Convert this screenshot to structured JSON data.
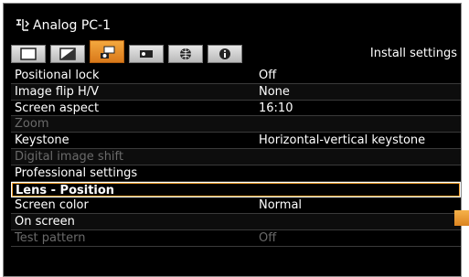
{
  "header": {
    "title": "Analog PC-1",
    "source_icon": "input-source-icon"
  },
  "tabs": [
    {
      "icon": "picture-adjust-icon"
    },
    {
      "icon": "image-adjust-icon"
    },
    {
      "icon": "install-settings-icon",
      "active": true
    },
    {
      "icon": "system-settings-icon"
    },
    {
      "icon": "network-settings-icon"
    },
    {
      "icon": "information-icon"
    }
  ],
  "section_label": "Install settings",
  "menu": {
    "items": [
      {
        "label": "Positional lock",
        "value": "Off",
        "enabled": true
      },
      {
        "label": "Image flip H/V",
        "value": "None",
        "enabled": true
      },
      {
        "label": "Screen aspect",
        "value": "16:10",
        "enabled": true
      },
      {
        "label": "Zoom",
        "value": "",
        "enabled": false
      },
      {
        "label": "Keystone",
        "value": "Horizontal-vertical keystone",
        "enabled": true
      },
      {
        "label": "Digital image shift",
        "value": "",
        "enabled": false
      },
      {
        "label": "Professional settings",
        "value": "",
        "enabled": true
      },
      {
        "label": "Lens - Position",
        "value": "",
        "enabled": true,
        "selected": true
      },
      {
        "label": "Screen color",
        "value": "Normal",
        "enabled": true
      },
      {
        "label": "On screen",
        "value": "",
        "enabled": true
      },
      {
        "label": "Test pattern",
        "value": "Off",
        "enabled": false
      }
    ]
  },
  "colors": {
    "background": "#000000",
    "text": "#ffffff",
    "disabled_text": "#6a6a6a",
    "accent": "#f0a030"
  }
}
